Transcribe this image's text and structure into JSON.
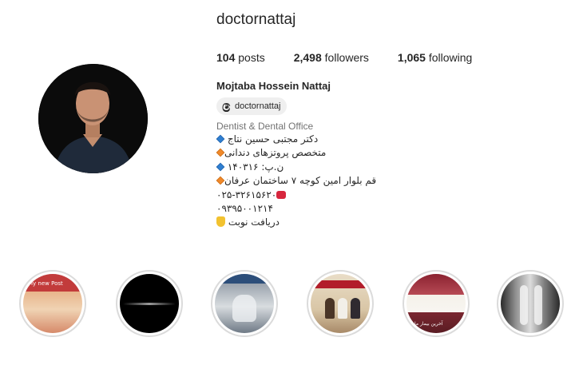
{
  "profile": {
    "username": "doctornattaj",
    "full_name": "Mojtaba Hossein Nattaj",
    "threads_handle": "doctornattaj",
    "category": "Dentist & Dental Office"
  },
  "stats": {
    "posts_count": "104",
    "posts_label": " posts",
    "followers_count": "2,498",
    "followers_label": " followers",
    "following_count": "1,065",
    "following_label": " following"
  },
  "bio": {
    "line1": "دکتر مجتبی حسین نتاج",
    "line2": "متخصص پروتزهای دندانی",
    "line3": "ن.پ: ۱۴۰۳۱۶",
    "line4": "قم بلوار امین کوچه ۷ ساختمان عرفان",
    "line5": "۰۲۵-۳۲۶۱۵۶۲۰",
    "line6": "۰۹۳۹۵۰۰۱۲۱۴",
    "line7": "دریافت نوبت"
  },
  "highlights": {
    "h1_label": "My new Post",
    "h5_caption": "آخرین بیمار ما"
  },
  "icons": {
    "threads": "threads-icon",
    "blue_diamond": "small-blue-diamond-icon",
    "orange_diamond": "small-orange-diamond-icon",
    "phone": "telephone-icon",
    "hand": "backhand-index-pointing-down-icon"
  },
  "colors": {
    "text": "#262626",
    "muted": "#737373",
    "highlight_ring": "#dbdbdb",
    "pill_bg": "#efefef"
  }
}
